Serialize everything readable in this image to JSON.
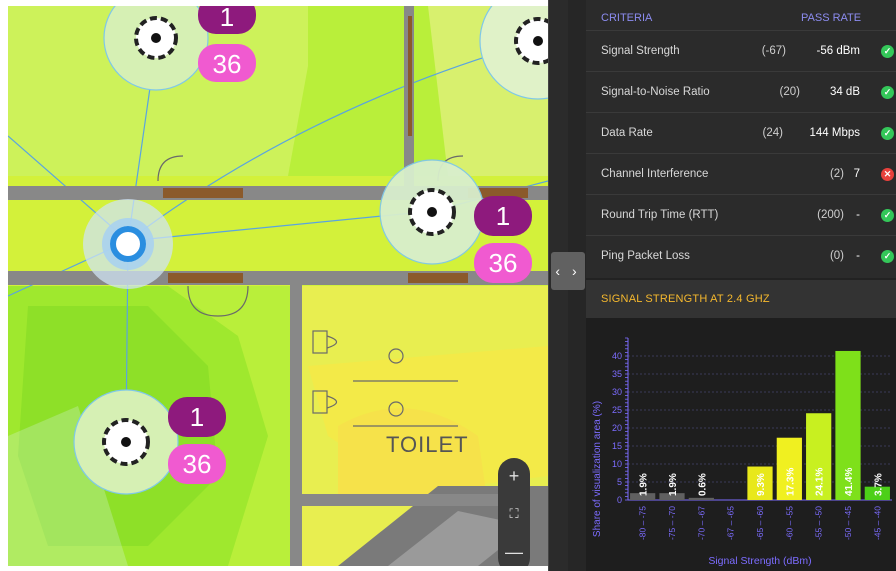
{
  "criteria": {
    "header": {
      "col1": "CRITERIA",
      "col2": "PASS RATE"
    },
    "rows": [
      {
        "label": "Signal Strength",
        "threshold": "(-67)",
        "value": "-56 dBm",
        "status": "pass"
      },
      {
        "label": "Signal-to-Noise Ratio",
        "threshold": "(20)",
        "value": "34 dB",
        "status": "pass"
      },
      {
        "label": "Data Rate",
        "threshold": "(24)",
        "value": "144 Mbps",
        "status": "pass"
      },
      {
        "label": "Channel Interference",
        "threshold": "(2)",
        "value": "7",
        "status": "fail"
      },
      {
        "label": "Round Trip Time (RTT)",
        "threshold": "(200)",
        "value": "-",
        "status": "pass"
      },
      {
        "label": "Ping Packet Loss",
        "threshold": "(0)",
        "value": "-",
        "status": "pass"
      }
    ]
  },
  "section_title": "SIGNAL STRENGTH AT 2.4 GHZ",
  "map": {
    "aps": [
      {
        "top": "1",
        "bottom": "36"
      },
      {
        "top": "1",
        "bottom": "36"
      },
      {
        "top": "1",
        "bottom": "36"
      }
    ],
    "room_label": "TOILET",
    "zoom_in": "+",
    "zoom_fit": "⛶",
    "zoom_out": "—"
  },
  "panel_toggle": "‹ ›",
  "colors": {
    "pass": "#34c759",
    "fail": "#e8413c",
    "header_text": "#8c8cf0",
    "section_title": "#f5b82e",
    "badge_top": "#8e1a7d",
    "badge_bottom": "#f05ad0",
    "chart_axis": "#7c6cff"
  },
  "chart_data": {
    "type": "bar",
    "xlabel": "Signal Strength (dBm)",
    "ylabel": "Share of visualization area (%)",
    "ylim": [
      0,
      45
    ],
    "yticks": [
      0,
      5,
      10,
      15,
      20,
      25,
      30,
      35,
      40
    ],
    "categories": [
      "-80 – -75",
      "-75 – -70",
      "-70 – -67",
      "-67 – -65",
      "-65 – -60",
      "-60 – -55",
      "-55 – -50",
      "-50 – -45",
      "-45 – -40"
    ],
    "values": [
      1.9,
      1.9,
      0.6,
      0,
      9.3,
      17.3,
      24.1,
      41.4,
      3.7
    ],
    "labels": [
      "1.9%",
      "1.9%",
      "0.6%",
      "",
      "9.3%",
      "17.3%",
      "24.1%",
      "41.4%",
      "3.7%"
    ],
    "bar_colors": [
      "#606060",
      "#606060",
      "#606060",
      "#606060",
      "#e8e81a",
      "#f0f020",
      "#c8f020",
      "#7ee01a",
      "#4cd018"
    ],
    "grid": true
  }
}
